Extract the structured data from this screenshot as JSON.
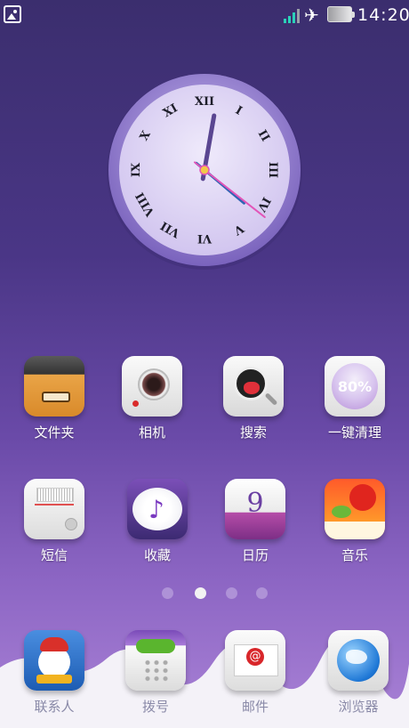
{
  "status_bar": {
    "time": "14:20",
    "icons": [
      "gallery-icon",
      "signal-icon",
      "airplane-icon",
      "battery-icon"
    ]
  },
  "clock_widget": {
    "hour_numerals": [
      "XII",
      "I",
      "II",
      "III",
      "IV",
      "V",
      "VI",
      "VII",
      "VIII",
      "IX",
      "X",
      "XI"
    ],
    "displayed_time": "12:20",
    "colors": {
      "hour_hand": "#5a4691",
      "minute_hand": "#2f64b4",
      "second_hand": "#e255b8",
      "face": "#dcd3f2",
      "rim": "#b9a9e4"
    }
  },
  "apps_row1": [
    {
      "label": "文件夹",
      "icon": "folder-icon"
    },
    {
      "label": "相机",
      "icon": "camera-icon"
    },
    {
      "label": "搜索",
      "icon": "search-icon"
    },
    {
      "label": "一键清理",
      "icon": "clean-icon",
      "badge": "80%"
    }
  ],
  "apps_row2": [
    {
      "label": "短信",
      "icon": "sms-icon"
    },
    {
      "label": "收藏",
      "icon": "favorites-icon"
    },
    {
      "label": "日历",
      "icon": "calendar-icon",
      "day": "9"
    },
    {
      "label": "音乐",
      "icon": "music-icon"
    }
  ],
  "page_indicator": {
    "count": 4,
    "active_index": 1
  },
  "dock": [
    {
      "label": "联系人",
      "icon": "contacts-icon"
    },
    {
      "label": "拨号",
      "icon": "dialer-icon"
    },
    {
      "label": "邮件",
      "icon": "mail-icon"
    },
    {
      "label": "浏览器",
      "icon": "browser-icon"
    }
  ],
  "theme_colors": {
    "background_top": "#3b2e6e",
    "background_bottom": "#a982d6",
    "dock_wave": "#f4f2f8"
  }
}
